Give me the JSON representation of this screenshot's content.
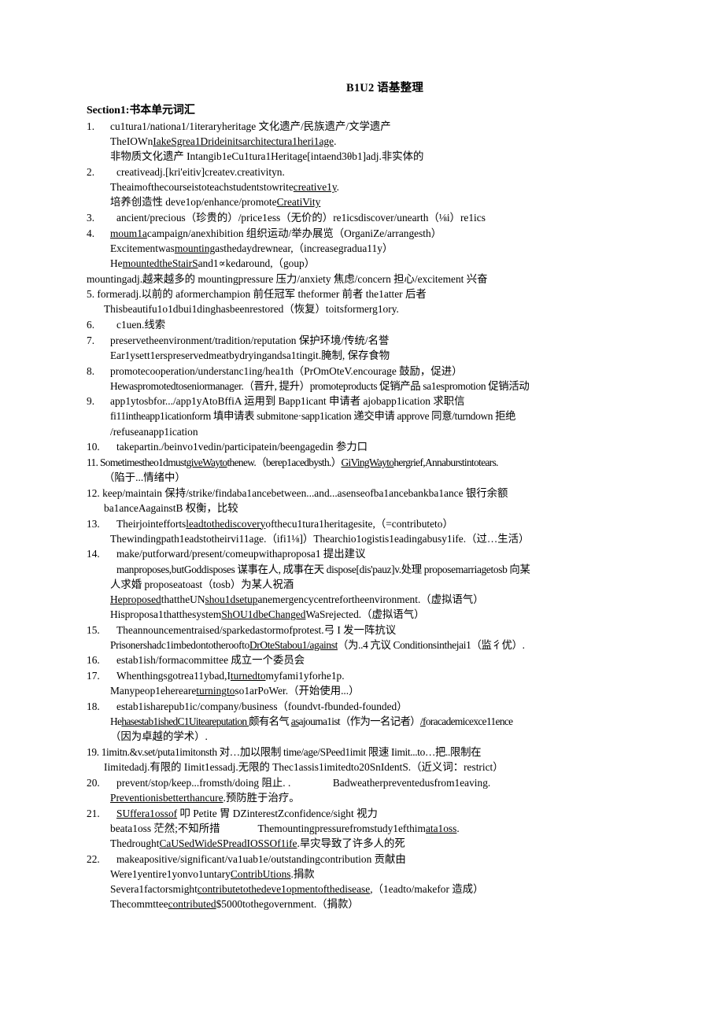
{
  "document": {
    "title": "B1U2 语基整理",
    "section_heading": "Section1:书本单元词汇",
    "entries": [
      {
        "number": "1.",
        "lines": [
          "cu1tura1/nationa1/1iteraryheritage 文化遗产/民族遗产/文学遗产",
          "TheIOWnIakeSgrea1Drideinitsarchitectura1heri1age.",
          "非物质文化遗产 Intangib1eCu1tura1Heritage[intaend3θb1]adj.非实体的"
        ]
      },
      {
        "number": "2.",
        "lines": [
          "creativeadj.[kri'eitiv]createv.creativityn.",
          "Theaimofthecourseistoteachstudentstowritecreative1y.",
          "培养创造性 deve1op/enhance/promoteCreatiVity"
        ]
      },
      {
        "number": "3.",
        "lines": [
          "ancient/precious（珍贵的）/price1ess（无价的）re1icsdiscover/unearth（⅛i）re1ics"
        ]
      },
      {
        "number": "4.",
        "lines": [
          "moum1acampaign/anexhibition 组织运动/举办展览（OrganiZe/arrangesth）",
          "Excitementwasmountingasthedaydrewnear,（increasegradua11y）",
          "HemountedtheStairSand1∝kedaround,（goup）"
        ]
      },
      {
        "number": "",
        "lines": [
          "mountingadj.越来越多的 mountingpressure 压力/anxiety 焦虑/concern 担心/excitement 兴奋"
        ]
      },
      {
        "number": "5.",
        "lines": [
          "formeradj.以前的 aformerchampion 前任冠军 theformer 前者 the1atter 后者",
          "Thisbeautifu1o1dbui1dinghasbeenrestored（恢复）toitsformerg1ory."
        ]
      },
      {
        "number": "6.",
        "lines": [
          "c1uen.线索"
        ]
      },
      {
        "number": "7.",
        "lines": [
          "preservetheenvironment/tradition/reputation 保护环境/传统/名誉",
          "Ear1ysett1erspreservedmeatbydryingandsa1tingit.腌制, 保存食物"
        ]
      },
      {
        "number": "8.",
        "lines": [
          "promotecooperation/understanc1ing/hea1th（PrOmOteV.encourage 鼓励，促进）",
          "Hewaspromotedtoseniormanager.（晋升, 提升）promoteproducts 促销产品 sa1espromotion 促销活动"
        ]
      },
      {
        "number": "9.",
        "lines": [
          "app1ytosbfor.../app1yAtoBffiA 运用到 Bapp1icant 申请者 ajobapp1ication 求职信",
          "fi11intheapp1icationform 填申请表 submitone·sapp1ication 递交申请 approve 同意/turndown 拒绝",
          "/refuseanapp1ication"
        ]
      },
      {
        "number": "10.",
        "lines": [
          "takepartin./beinvo1vedin/participatein/beengagedin 参力口"
        ]
      },
      {
        "number": "11.",
        "lines": [
          "Sometimestheo1dmustgiveWaytothenew.（berep1acedbysth.）GiVingWaytohergrief,Annaburstintotears.",
          "（陷于...情绪中）"
        ]
      },
      {
        "number": "12.",
        "lines": [
          "keep/maintain 保持/strike/findaba1ancebetween...and...asenseofba1ancebankba1ance 银行余额",
          "ba1anceAagainstB 权衡，比较"
        ]
      },
      {
        "number": "13.",
        "lines": [
          "Theirjointeffortsleadtothediscoveryofthecu1tura1heritagesite,（=contributeto）",
          "Thewindingpath1eadstotheirvi11age.（ifi1⅛]）Thearchio1ogistis1eadingabusy1ife.（过…生活）"
        ]
      },
      {
        "number": "14.",
        "lines": [
          "make/putforward/present/comeupwithaproposa1 提出建议",
          "manproposes,butGoddisposes 谋事在人, 成事在天 dispose[dis'pauz]v.处理 proposemarriagetosb 向某",
          "人求婚 proposeatoast（tosb）为某人祝酒",
          "HeproposedthattheUNshou1dsetupanemergencycentrefortheenvironment.（虚拟语气）",
          "Hisproposa1thatthesystemShOU1dbeChangedWaSrejected.（虚拟语气）"
        ]
      },
      {
        "number": "15.",
        "lines": [
          "Theannouncementraised/sparkedastormofprotest.弓 I 发一阵抗议",
          "Prisonershadc1imbedontotherooftoDrOteStabou1/against（为..4 亢议 Conditionsinthejai1（监彳优）."
        ]
      },
      {
        "number": "16.",
        "lines": [
          "estab1ish/formacommittee 成立一个委员会"
        ]
      },
      {
        "number": "17.",
        "lines": [
          "Whenthingsgotrea11ybad,Iturnedtomyfami1yforhe1p.",
          "Manypeop1ehereareturningtoso1arPoWer.（开始使用...）"
        ]
      },
      {
        "number": "18.",
        "lines": [
          "estab1isharepub1ic/company/business（foundvt-fbunded-founded）",
          "HehasestablishedC1Uiteareputation 颇有名气 asajourna1ist（作为一名记者）/foracademicexce11ence",
          "（因为卓越的学术）."
        ]
      },
      {
        "number": "19.",
        "lines": [
          "1imitn.&v.set/puta1imitonsth 对…加以限制 time/age/SPeed1imit 限速 Iimit...to…把..限制在",
          "Iimitedadj.有限的 Iimit1essadj.无限的 Thec1assis1imitedto20SnIdentS.（近义词：restrict）"
        ]
      },
      {
        "number": "20.",
        "lines": [
          "prevent/stop/keep...fromsth/doing 阻止. .                Badweatherpreventedusfrom1eaving.",
          "Preventionisbetterthancure.预防胜于治疗。"
        ]
      },
      {
        "number": "21.",
        "lines": [
          "SUffera1ossof 叩 Petite 胃 DZinterestZconfidence/sight 视力",
          "beata1oss 茫然;不知所措        Themountingpressurefromstudy1efthimata1oss.",
          "ThedroughtCaUSedWideSPreadIOSSOf1ife.旱灾导致了许多人的死"
        ]
      },
      {
        "number": "22.",
        "lines": [
          "makeapositive/significant/va1uab1e/outstandingcontribution 贡献由",
          "Were1yentire1yonvo1untaryContribUtions.捐款",
          "Severa1factorsmightcontributetothedeve1opmentofthedisease,（1eadto/makefor 造成）",
          "Thecommtteecontributed$5000tothegovernment.（捐款）"
        ]
      }
    ]
  }
}
